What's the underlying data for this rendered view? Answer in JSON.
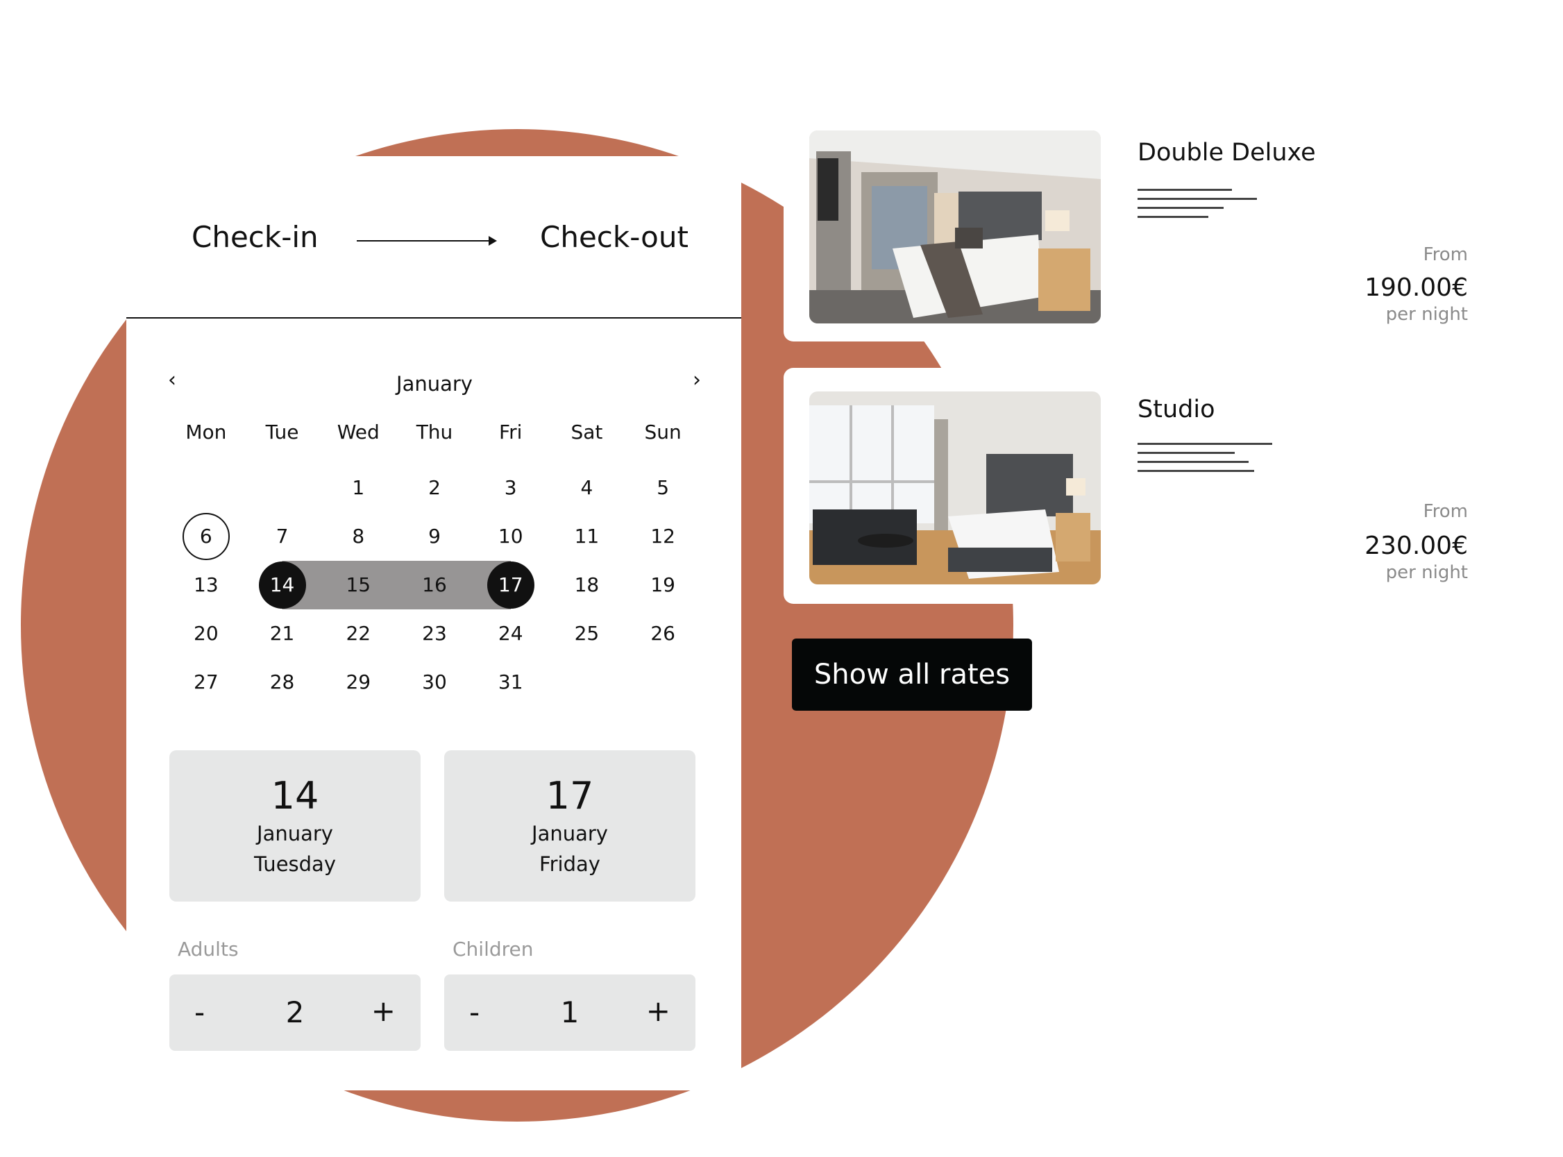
{
  "header": {
    "checkin_label": "Check-in",
    "checkout_label": "Check-out"
  },
  "calendar": {
    "month": "January",
    "prev_icon": "‹",
    "next_icon": "›",
    "weekdays": [
      "Mon",
      "Tue",
      "Wed",
      "Thu",
      "Fri",
      "Sat",
      "Sun"
    ],
    "leading_blanks": 2,
    "days_in_month": 31,
    "today": 6,
    "range_start": 14,
    "range_end": 17
  },
  "summary": {
    "checkin": {
      "day": "14",
      "month": "January",
      "weekday": "Tuesday"
    },
    "checkout": {
      "day": "17",
      "month": "January",
      "weekday": "Friday"
    }
  },
  "guests": {
    "adults": {
      "label": "Adults",
      "value": "2",
      "minus": "-",
      "plus": "+"
    },
    "children": {
      "label": "Children",
      "value": "1",
      "minus": "-",
      "plus": "+"
    }
  },
  "rooms": [
    {
      "name": "Double Deluxe",
      "from_label": "From",
      "price": "190.00€",
      "per_night": "per night"
    },
    {
      "name": "Studio",
      "from_label": "From",
      "price": "230.00€",
      "per_night": "per night"
    }
  ],
  "show_all_rates": "Show all rates",
  "colors": {
    "accent": "#c07055",
    "range": "#979595",
    "box": "#e6e7e7",
    "button": "#050707"
  }
}
